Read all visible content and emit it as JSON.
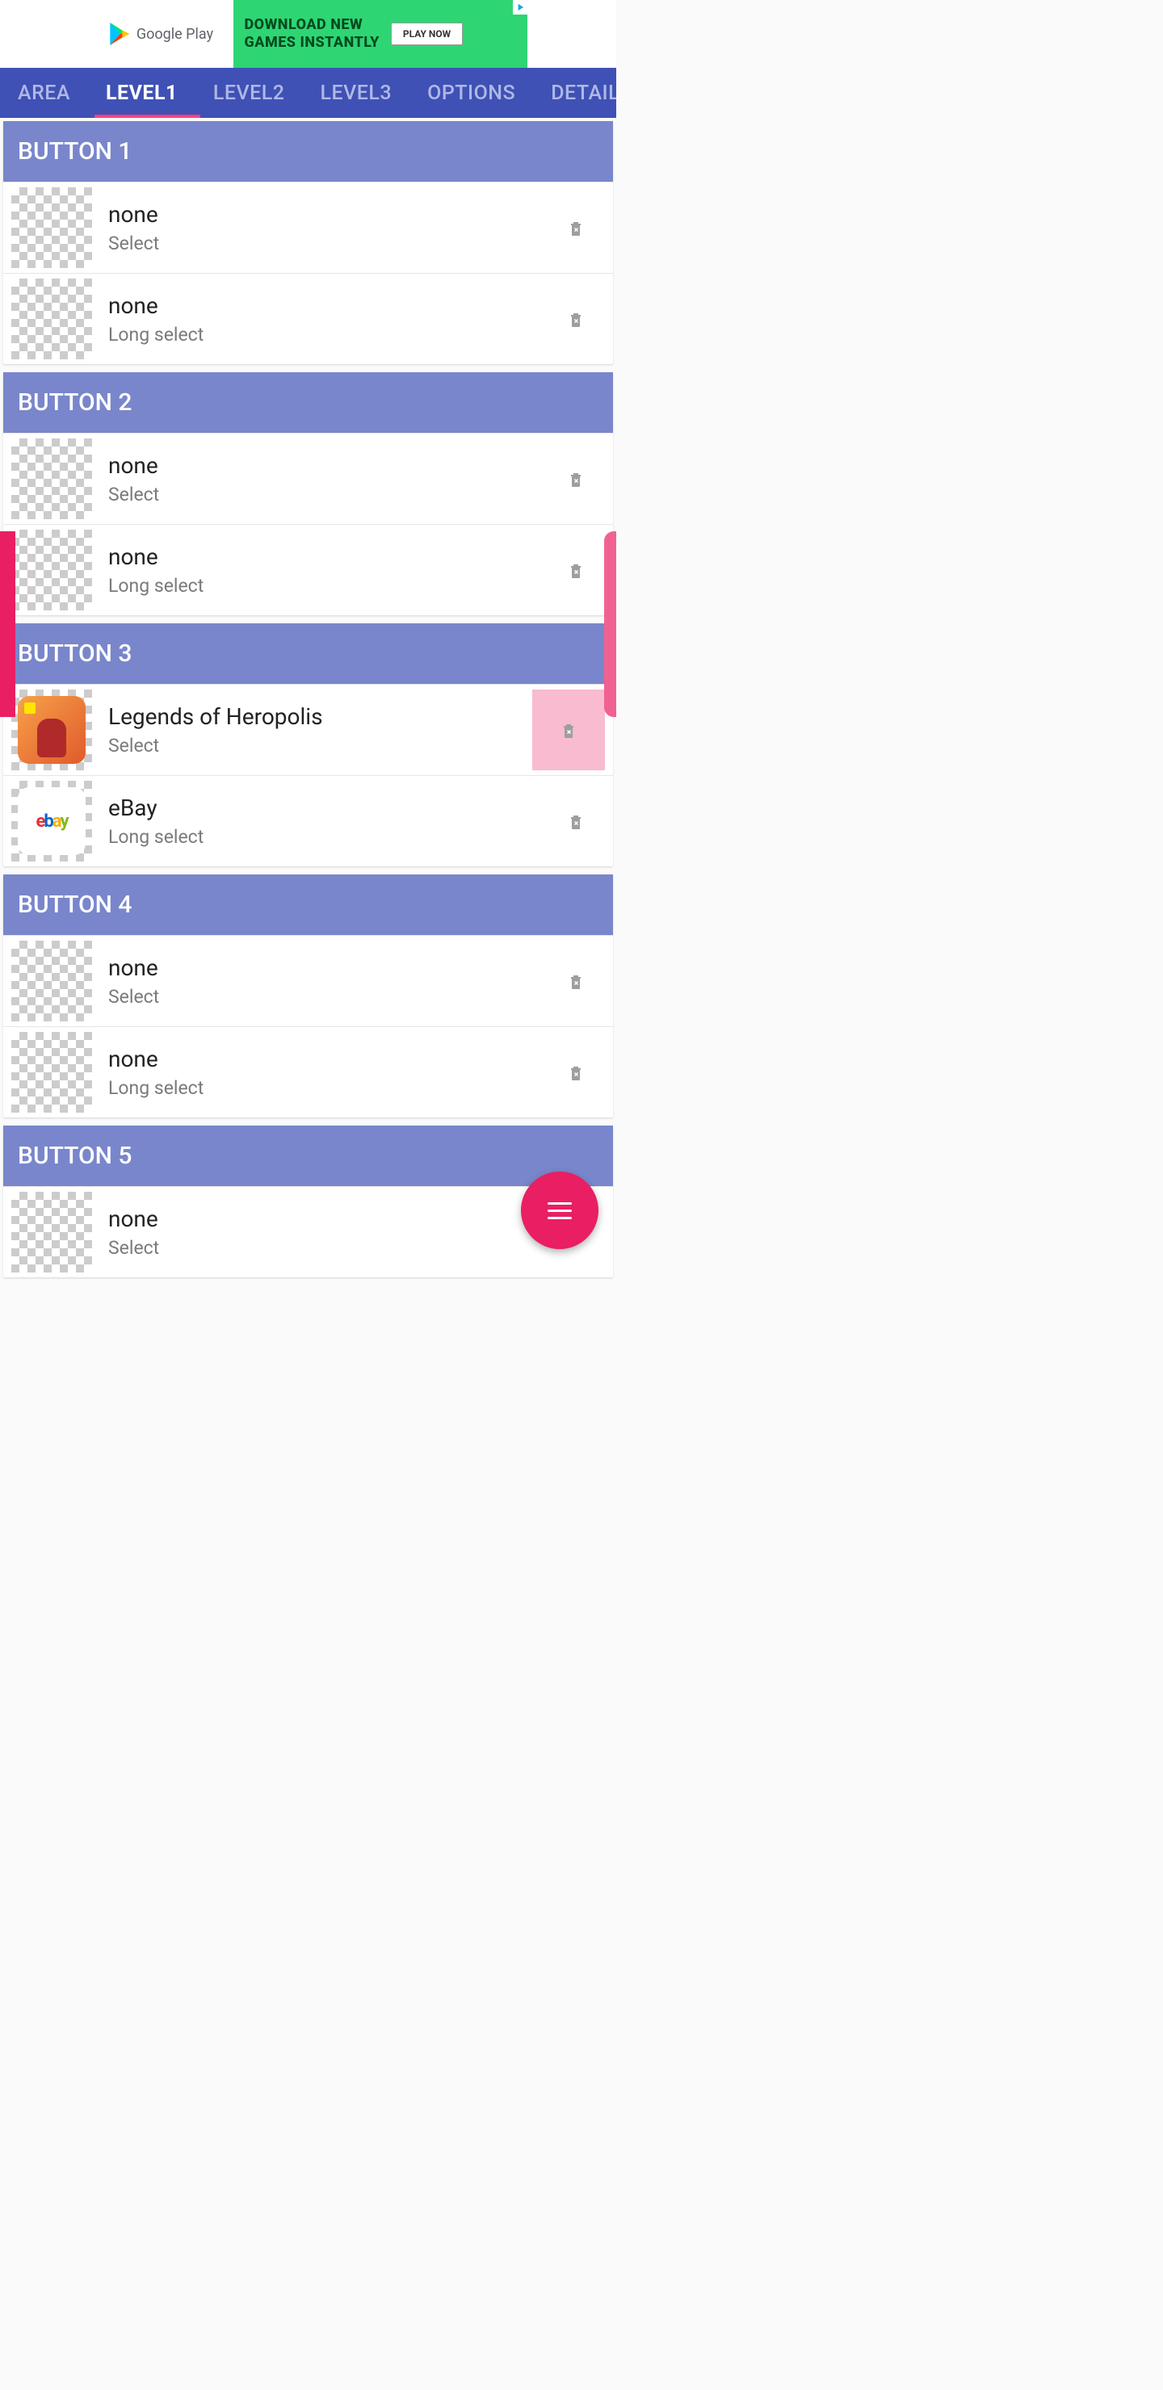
{
  "ad": {
    "store": "Google Play",
    "headline_l1": "DOWNLOAD NEW",
    "headline_l2": "GAMES INSTANTLY",
    "cta": "PLAY NOW"
  },
  "tabs": [
    "AREA",
    "LEVEL1",
    "LEVEL2",
    "LEVEL3",
    "OPTIONS",
    "DETAIL"
  ],
  "active_tab": 1,
  "sections": [
    {
      "header": "BUTTON 1",
      "rows": [
        {
          "title": "none",
          "sub": "Select",
          "icon": "none",
          "hl": false
        },
        {
          "title": "none",
          "sub": "Long select",
          "icon": "none",
          "hl": false
        }
      ]
    },
    {
      "header": "BUTTON 2",
      "rows": [
        {
          "title": "none",
          "sub": "Select",
          "icon": "none",
          "hl": false
        },
        {
          "title": "none",
          "sub": "Long select",
          "icon": "none",
          "hl": false
        }
      ]
    },
    {
      "header": "BUTTON 3",
      "rows": [
        {
          "title": "Legends of Heropolis",
          "sub": "Select",
          "icon": "heropolis",
          "hl": true
        },
        {
          "title": "eBay",
          "sub": "Long select",
          "icon": "ebay",
          "hl": false
        }
      ]
    },
    {
      "header": "BUTTON 4",
      "rows": [
        {
          "title": "none",
          "sub": "Select",
          "icon": "none",
          "hl": false
        },
        {
          "title": "none",
          "sub": "Long select",
          "icon": "none",
          "hl": false
        }
      ]
    },
    {
      "header": "BUTTON 5",
      "rows": [
        {
          "title": "none",
          "sub": "Select",
          "icon": "none",
          "hl": false
        }
      ]
    }
  ]
}
